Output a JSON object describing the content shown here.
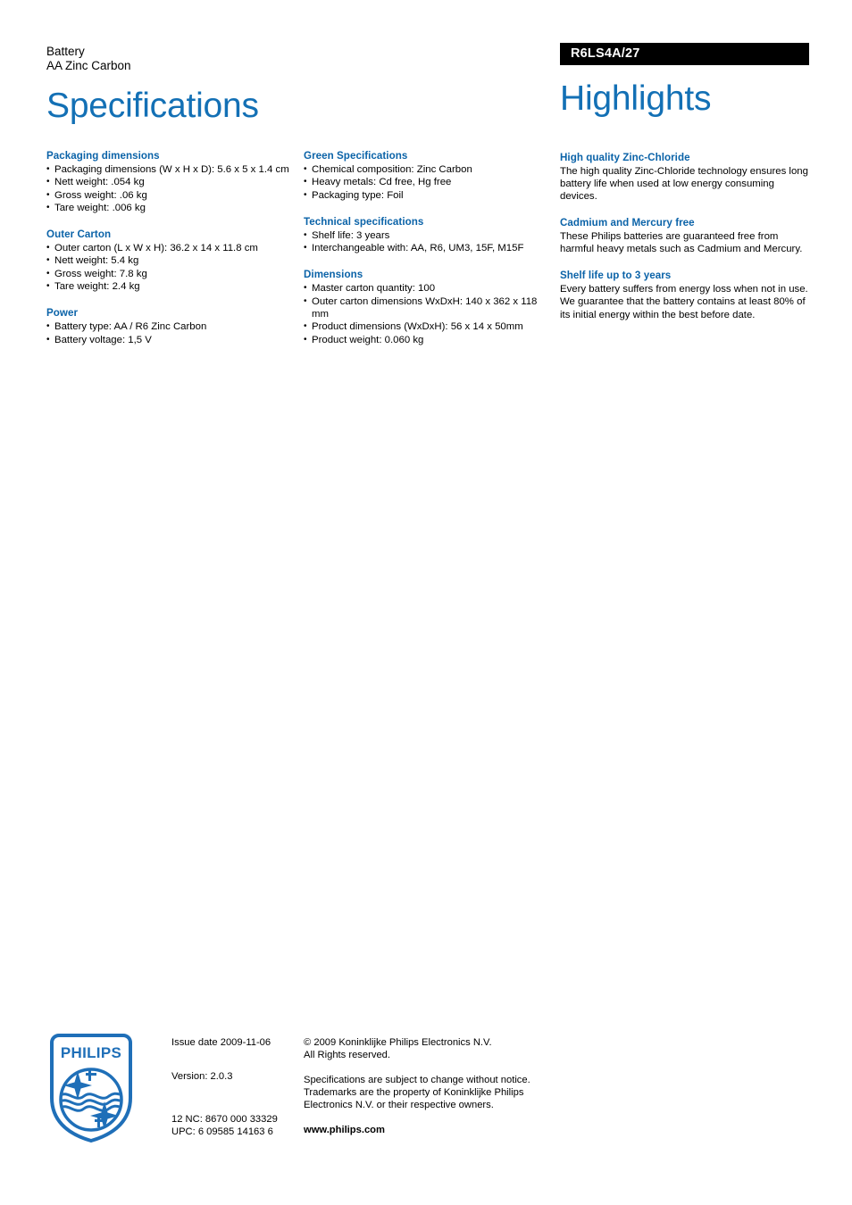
{
  "header": {
    "product_category": "Battery",
    "product_subtitle": "AA Zinc Carbon",
    "left_title": "Specifications",
    "product_code": "R6LS4A/27",
    "right_title": "Highlights"
  },
  "colors": {
    "heading_blue": "#1370b5",
    "section_blue": "#0b63a8",
    "code_bar_bg": "#000000",
    "logo_blue": "#1f6fb8"
  },
  "spec_columns": [
    {
      "sections": [
        {
          "title": "Packaging dimensions",
          "items": [
            "Packaging dimensions (W x H x D): 5.6 x 5 x 1.4 cm",
            "Nett weight: .054 kg",
            "Gross weight: .06 kg",
            "Tare weight: .006 kg"
          ]
        },
        {
          "title": "Outer Carton",
          "items": [
            "Outer carton (L x W x H): 36.2 x 14 x 11.8 cm",
            "Nett weight: 5.4 kg",
            "Gross weight: 7.8 kg",
            "Tare weight: 2.4 kg"
          ]
        },
        {
          "title": "Power",
          "items": [
            "Battery type: AA / R6 Zinc Carbon",
            "Battery voltage: 1,5 V"
          ]
        }
      ]
    },
    {
      "sections": [
        {
          "title": "Green Specifications",
          "items": [
            "Chemical composition: Zinc Carbon",
            "Heavy metals: Cd free, Hg free",
            "Packaging type: Foil"
          ]
        },
        {
          "title": "Technical specifications",
          "items": [
            "Shelf life: 3 years",
            "Interchangeable with: AA, R6, UM3, 15F, M15F"
          ]
        },
        {
          "title": "Dimensions",
          "items": [
            "Master carton quantity: 100",
            "Outer carton dimensions WxDxH: 140 x 362 x 118 mm",
            "Product dimensions (WxDxH): 56 x 14 x 50mm",
            "Product weight: 0.060 kg"
          ]
        }
      ]
    }
  ],
  "highlights": [
    {
      "title": "High quality Zinc-Chloride",
      "body": "The high quality Zinc-Chloride technology ensures long battery life when used at low energy consuming devices."
    },
    {
      "title": "Cadmium and Mercury free",
      "body": "These Philips batteries are guaranteed free from harmful heavy metals such as Cadmium and Mercury."
    },
    {
      "title": "Shelf life up to 3 years",
      "body": "Every battery suffers from energy loss when not in use. We guarantee that the battery contains at least 80% of its initial energy within the best before date."
    }
  ],
  "footer": {
    "logo_wordmark": "PHILIPS",
    "issue_date": "Issue date 2009-11-06",
    "version": "Version: 2.0.3",
    "nc_code": "12 NC: 8670 000 33329",
    "upc_code": "UPC: 6 09585 14163 6",
    "copyright_line1": "© 2009 Koninklijke Philips Electronics N.V.",
    "copyright_line2": "All Rights reserved.",
    "disclaimer": "Specifications are subject to change without notice. Trademarks are the property of Koninklijke Philips Electronics N.V. or their respective owners.",
    "website": "www.philips.com"
  }
}
